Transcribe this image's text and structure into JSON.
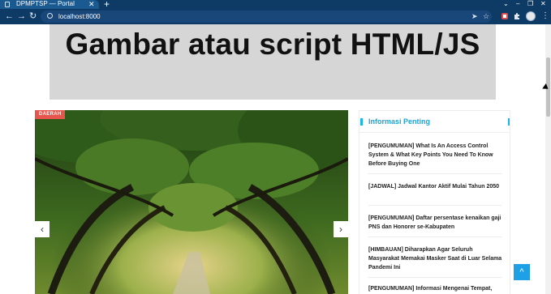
{
  "browser": {
    "tab_title": "DPMPTSP — Portal",
    "tab_close": "✕",
    "new_tab": "+",
    "url": "localhost:8000",
    "window_controls": {
      "collapse": "⌄",
      "minimize": "–",
      "maximize": "❐",
      "close": "✕"
    }
  },
  "banner": {
    "text": "Gambar atau script HTML/JS"
  },
  "slider": {
    "category": "DAERAH",
    "prev_arrow": "‹",
    "next_arrow": "›"
  },
  "sidebar": {
    "title": "Informasi Penting",
    "items": [
      {
        "text": "[PENGUMUMAN] What Is An Access Control System & What Key Points You Need To Know Before Buying One"
      },
      {
        "text": "[JADWAL] Jadwal Kantor Aktif Mulai Tahun 2050"
      },
      {
        "text": "[PENGUMUMAN] Daftar persentase kenaikan gaji PNS dan Honorer se-Kabupaten"
      },
      {
        "text": "[HIMBAUAN] Diharapkan Agar Seluruh Masyarakat Memakai Masker Saat di Luar Selama Pandemi Ini"
      },
      {
        "text": "[PENGUMUMAN] Informasi Mengenai Tempat,"
      }
    ]
  },
  "back_to_top": "^",
  "colors": {
    "chrome": "#0d3b66",
    "accent": "#19b5e6",
    "badge": "#e7554c",
    "back_to_top": "#1ea0e6"
  }
}
